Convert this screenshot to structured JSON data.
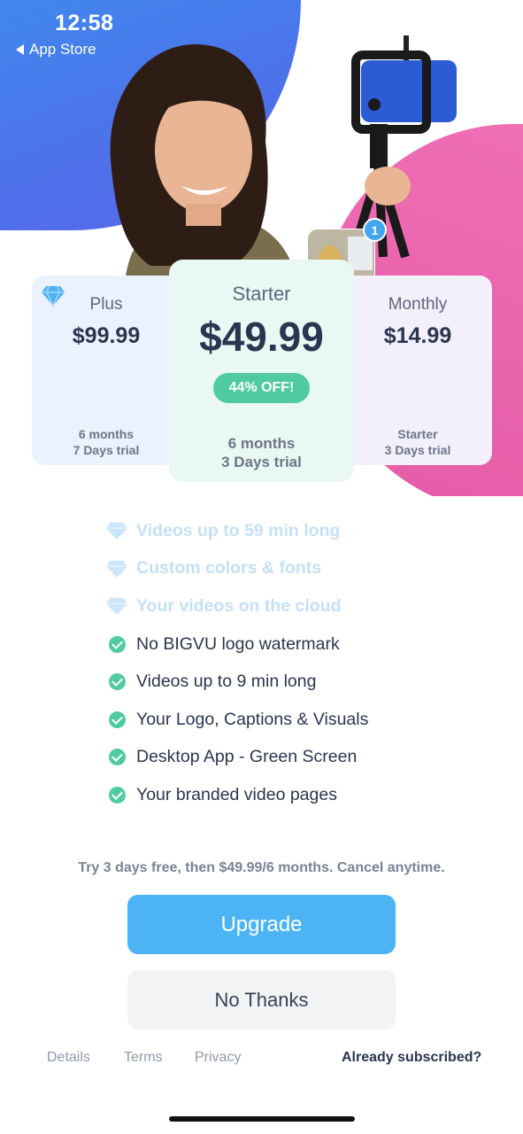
{
  "status_bar": {
    "time": "12:58",
    "back_label": "App Store"
  },
  "notification_badge": "1",
  "plans": [
    {
      "name": "Plus",
      "price": "$99.99",
      "term_line1": "6 months",
      "term_line2": "7 Days trial"
    },
    {
      "name": "Starter",
      "price": "$49.99",
      "discount": "44% OFF!",
      "term_line1": "6 months",
      "term_line2": "3 Days trial"
    },
    {
      "name": "Monthly",
      "price": "$14.99",
      "term_line1": "Starter",
      "term_line2": "3 Days trial"
    }
  ],
  "features": [
    {
      "label": "Videos up to 59 min long",
      "icon": "diamond-icon",
      "premium": true
    },
    {
      "label": "Custom colors & fonts",
      "icon": "diamond-icon",
      "premium": true
    },
    {
      "label": "Your videos on the cloud",
      "icon": "diamond-icon",
      "premium": true
    },
    {
      "label": "No BIGVU logo watermark",
      "icon": "check-icon",
      "premium": false
    },
    {
      "label": "Videos up to 9 min long",
      "icon": "check-icon",
      "premium": false
    },
    {
      "label": "Your Logo, Captions & Visuals",
      "icon": "check-icon",
      "premium": false
    },
    {
      "label": "Desktop App - Green Screen",
      "icon": "check-icon",
      "premium": false
    },
    {
      "label": "Your branded video pages",
      "icon": "check-icon",
      "premium": false
    }
  ],
  "trial_text": "Try 3 days free, then $49.99/6 months. Cancel anytime.",
  "buttons": {
    "upgrade": "Upgrade",
    "no_thanks": "No Thanks"
  },
  "footer": {
    "details": "Details",
    "terms": "Terms",
    "privacy": "Privacy",
    "already_subscribed": "Already subscribed?"
  },
  "colors": {
    "accent_blue": "#4cb4f4",
    "accent_green": "#4fcb9f",
    "hero_blue": "#4d72ea",
    "hero_pink": "#e55aa7"
  }
}
